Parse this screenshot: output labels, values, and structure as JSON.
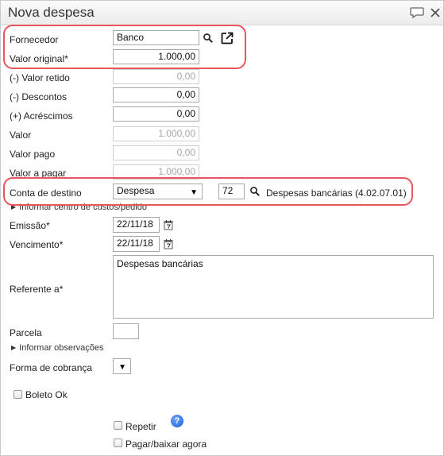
{
  "dialog": {
    "title": "Nova despesa"
  },
  "fields": {
    "fornecedor": {
      "label": "Fornecedor",
      "value": "Banco"
    },
    "valor_original": {
      "label": "Valor original*",
      "value": "1.000,00"
    },
    "valor_retido": {
      "label": "(-) Valor retido",
      "value": "0,00"
    },
    "descontos": {
      "label": "(-) Descontos",
      "value": "0,00"
    },
    "acrescimos": {
      "label": "(+) Acréscimos",
      "value": "0,00"
    },
    "valor": {
      "label": "Valor",
      "value": "1.000,00"
    },
    "valor_pago": {
      "label": "Valor pago",
      "value": "0,00"
    },
    "valor_a_pagar": {
      "label": "Valor a pagar",
      "value": "1.000,00"
    },
    "conta_destino": {
      "label": "Conta de destino",
      "selected": "Despesa",
      "code": "72",
      "description": "Despesas bancárias (4.02.07.01)"
    },
    "centro_custos": {
      "label": "Informar centro de custos/pedido"
    },
    "emissao": {
      "label": "Emissão*",
      "value": "22/11/18"
    },
    "vencimento": {
      "label": "Vencimento*",
      "value": "22/11/18"
    },
    "referente": {
      "label": "Referente a*",
      "value": "Despesas bancárias"
    },
    "parcela": {
      "label": "Parcela",
      "value": ""
    },
    "observacoes": {
      "label": "Informar observações"
    },
    "forma_cobranca": {
      "label": "Forma de cobrança",
      "value": ""
    },
    "boleto_ok": {
      "label": "Boleto Ok",
      "checked": false
    },
    "repetir": {
      "label": "Repetir",
      "checked": false
    },
    "pagar_baixar": {
      "label": "Pagar/baixar agora",
      "checked": false
    },
    "help": {
      "glyph": "?"
    }
  },
  "icons": [
    "chat-icon",
    "close-icon",
    "search-icon",
    "external-link-icon",
    "calendar-icon",
    "help-icon"
  ],
  "colors": {
    "highlight": "#e8555b",
    "help": "#1d5fd8"
  }
}
